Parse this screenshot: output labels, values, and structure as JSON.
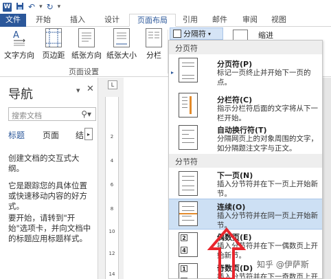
{
  "app": {
    "logo": "W"
  },
  "quick_access": {
    "save_icon": "save-icon",
    "undo_icon": "undo-icon",
    "redo_icon": "redo-icon"
  },
  "tabs": [
    "文件",
    "开始",
    "插入",
    "设计",
    "页面布局",
    "引用",
    "邮件",
    "审阅",
    "视图"
  ],
  "active_tab": "页面布局",
  "ribbon": {
    "buttons": [
      "文字方向",
      "页边距",
      "纸张方向",
      "纸张大小",
      "分栏"
    ],
    "group_label": "页面设置",
    "breaks_button": "分隔符",
    "indent_label": "缩进"
  },
  "navigation": {
    "title": "导航",
    "search_placeholder": "搜索文档",
    "tabs": [
      "标题",
      "页面",
      "结"
    ],
    "paragraphs": [
      "创建文档的交互式大纲。",
      "它是跟踪您的具体位置或快速移动内容的好方式。",
      "要开始，请转到\"开始\"选项卡，并向文档中的标题应用标题样式。"
    ]
  },
  "ruler": {
    "numbers": [
      "2",
      "4",
      "6",
      "8",
      "10",
      "12",
      "14"
    ]
  },
  "dropdown": {
    "section_page": "分页符",
    "section_section": "分节符",
    "items": [
      {
        "title": "分页符(P)",
        "desc": "标记一页终止并开始下一页的点。"
      },
      {
        "title": "分栏符(C)",
        "desc": "指示分栏符后面的文字将从下一栏开始。"
      },
      {
        "title": "自动换行符(T)",
        "desc": "分隔网页上的对象周围的文字，如分隔题注文字与正文。"
      },
      {
        "title": "下一页(N)",
        "desc": "插入分节符并在下一页上开始新节。"
      },
      {
        "title": "连续(O)",
        "desc": "插入分节符并在同一页上开始新节。"
      },
      {
        "title": "偶数页(E)",
        "desc": "插入分节符并在下一偶数页上开始新节。"
      },
      {
        "title": "奇数页(D)",
        "desc": "插入分节符并在下一奇数页上开始新节。"
      }
    ],
    "highlighted_index": 4
  },
  "watermark": "知乎 @伊萨斯",
  "colors": {
    "accent": "#2b579a",
    "highlight": "#cde0f4",
    "arrow": "#e8262d"
  }
}
